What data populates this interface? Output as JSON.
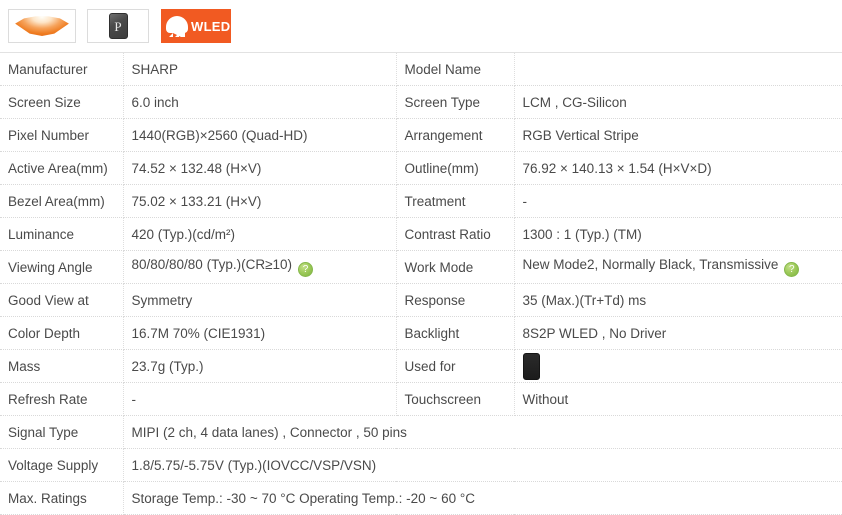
{
  "icons": {
    "lens_label": "viewing-angle-lens",
    "panel_letter": "P",
    "wled_label": "WLED"
  },
  "spec": {
    "half_rows": [
      {
        "left_label": "Manufacturer",
        "left_value": "SHARP",
        "right_label": "Model Name",
        "right_value": ""
      },
      {
        "left_label": "Screen Size",
        "left_value": "6.0 inch",
        "right_label": "Screen Type",
        "right_value": "LCM ,   CG-Silicon"
      },
      {
        "left_label": "Pixel Number",
        "left_value": "1440(RGB)×2560   (Quad-HD)",
        "right_label": "Arrangement",
        "right_value": "RGB Vertical Stripe"
      },
      {
        "left_label": "Active Area(mm)",
        "left_value": "74.52 × 132.48 (H×V)",
        "right_label": "Outline(mm)",
        "right_value": "76.92 × 140.13 × 1.54 (H×V×D)"
      },
      {
        "left_label": "Bezel Area(mm)",
        "left_value": "75.02 × 133.21 (H×V)",
        "right_label": "Treatment",
        "right_value": "-"
      },
      {
        "left_label": "Luminance",
        "left_value": "420 (Typ.)(cd/m²)",
        "right_label": "Contrast Ratio",
        "right_value": "1300 : 1 (Typ.) (TM)"
      },
      {
        "left_label": "Viewing Angle",
        "left_value": "80/80/80/80 (Typ.)(CR≥10)",
        "left_help": "?",
        "right_label": "Work Mode",
        "right_value": "New Mode2, Normally Black, Transmissive",
        "right_help": "?"
      },
      {
        "left_label": "Good View at",
        "left_value": "Symmetry",
        "right_label": "Response",
        "right_value": "35 (Max.)(Tr+Td) ms"
      },
      {
        "left_label": "Color Depth",
        "left_value": "16.7M   70% (CIE1931)",
        "right_label": "Backlight",
        "right_value": "8S2P WLED , No Driver"
      },
      {
        "left_label": "Mass",
        "left_value": "23.7g (Typ.)",
        "right_label": "Used for",
        "right_value": "",
        "right_icon": "smartphone-icon"
      },
      {
        "left_label": "Refresh Rate",
        "left_value": "-",
        "right_label": "Touchscreen",
        "right_value": "Without"
      }
    ],
    "full_rows": [
      {
        "label": "Signal Type",
        "value": "MIPI (2 ch, 4 data lanes) , Connector , 50 pins"
      },
      {
        "label": "Voltage Supply",
        "value": "1.8/5.75/-5.75V (Typ.)(IOVCC/VSP/VSN)"
      },
      {
        "label": "Max. Ratings",
        "value": "Storage Temp.: -30 ~ 70 °C   Operating Temp.: -20 ~ 60 °C"
      }
    ]
  }
}
